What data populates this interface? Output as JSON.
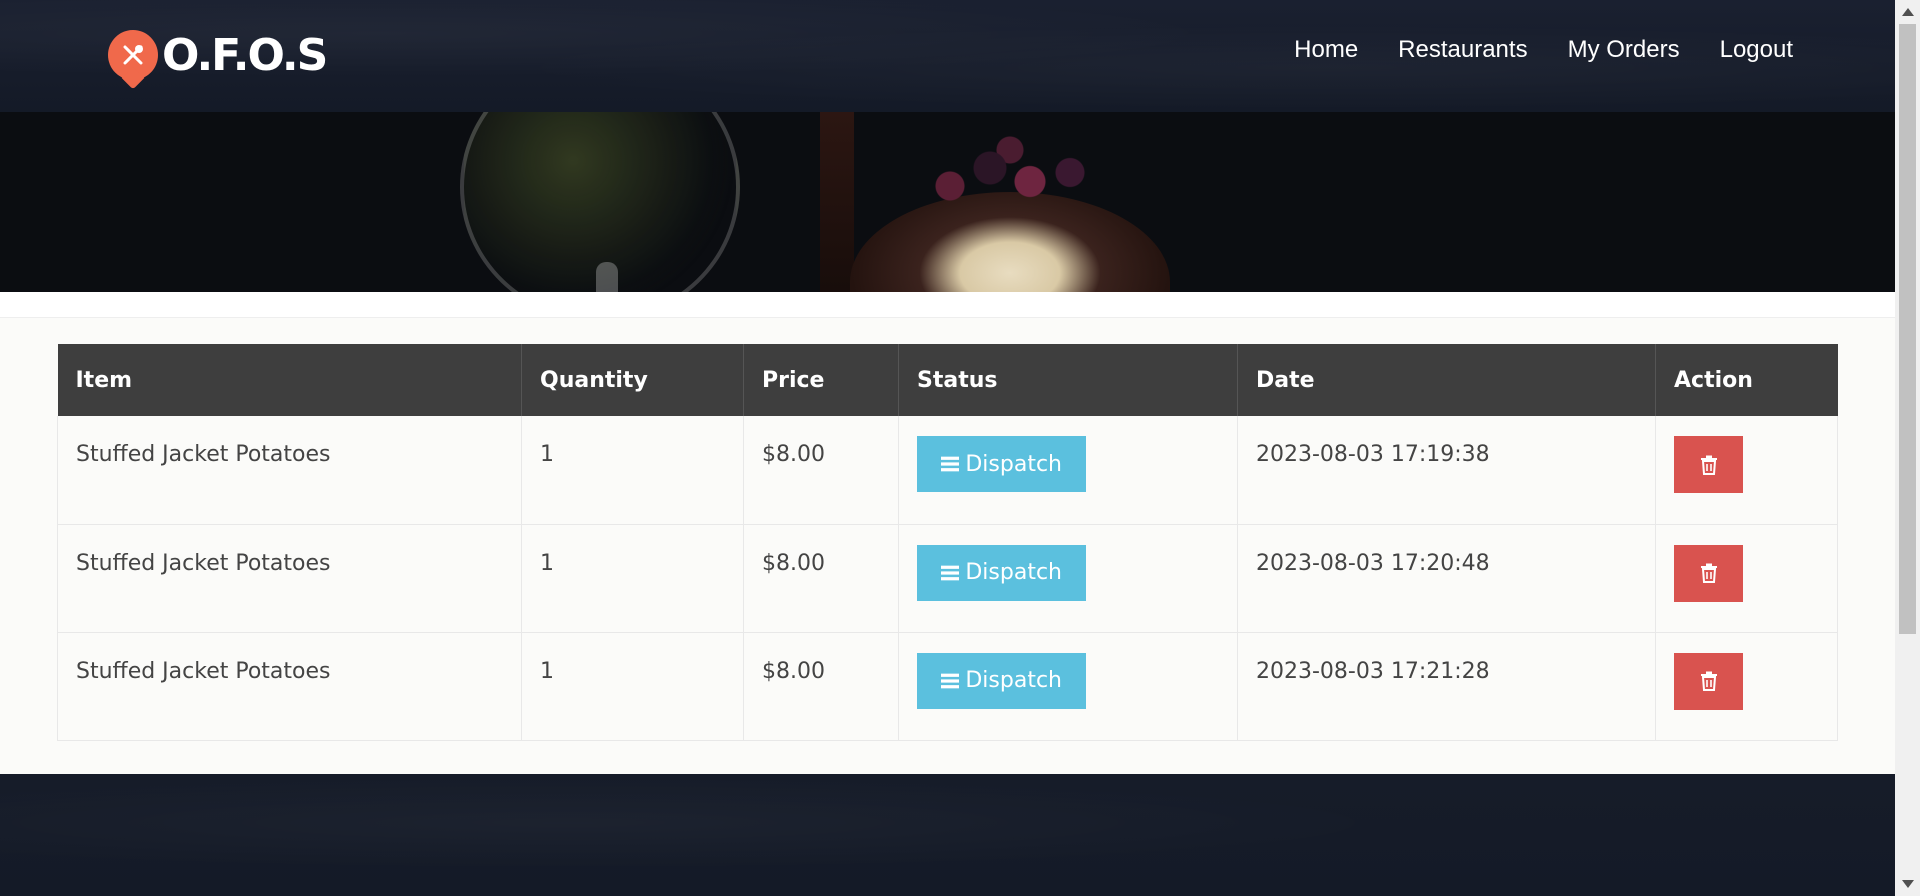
{
  "header": {
    "logo_text": "O.F.O.S",
    "nav": [
      {
        "label": "Home"
      },
      {
        "label": "Restaurants"
      },
      {
        "label": "My Orders"
      },
      {
        "label": "Logout"
      }
    ]
  },
  "orders_table": {
    "columns": [
      "Item",
      "Quantity",
      "Price",
      "Status",
      "Date",
      "Action"
    ],
    "rows": [
      {
        "item": "Stuffed Jacket Potatoes",
        "quantity": "1",
        "price": "$8.00",
        "status": "Dispatch",
        "date": "2023-08-03 17:19:38"
      },
      {
        "item": "Stuffed Jacket Potatoes",
        "quantity": "1",
        "price": "$8.00",
        "status": "Dispatch",
        "date": "2023-08-03 17:20:48"
      },
      {
        "item": "Stuffed Jacket Potatoes",
        "quantity": "1",
        "price": "$8.00",
        "status": "Dispatch",
        "date": "2023-08-03 17:21:28"
      }
    ]
  },
  "colors": {
    "header_bg": "#171d2b",
    "logo_accent": "#f0694b",
    "table_header_bg": "#3e3e3e",
    "dispatch_button": "#5bc0de",
    "delete_button": "#d9534f"
  },
  "icons": {
    "logo": "fork-knife-pin-icon",
    "status": "bars-icon",
    "delete": "trash-icon"
  }
}
